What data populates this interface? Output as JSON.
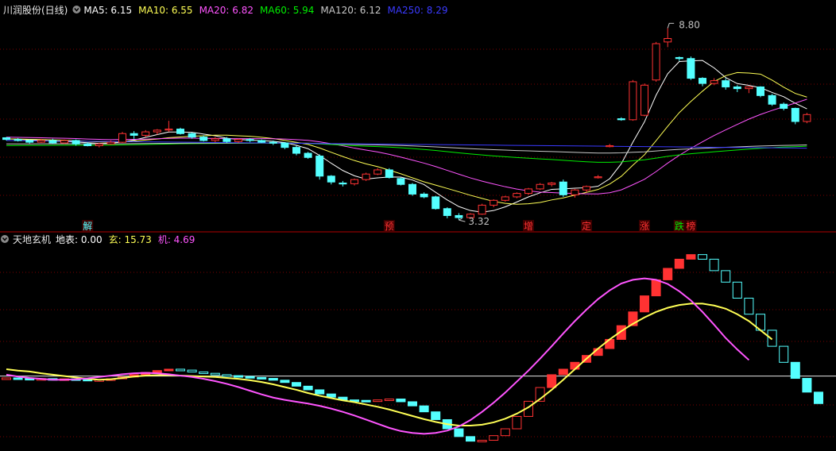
{
  "colors": {
    "background": "#000000",
    "grid": "#7a0000",
    "separator": "#b00000",
    "up": "#ff3232",
    "down": "#54ffff",
    "white": "#e0e0e0",
    "ma5": "#ffffff",
    "ma10": "#ffff55",
    "ma20": "#ff55ff",
    "ma60": "#00ee00",
    "ma120": "#c8c8c8",
    "ma250": "#3a3aff",
    "label_up": "#ff3232",
    "label_cyan": "#54ffff",
    "label_green": "#00ee00"
  },
  "top_panel": {
    "title": "川润股份(日线)",
    "legend": [
      {
        "name": "MA5",
        "value": "6.15",
        "color": "#ffffff"
      },
      {
        "name": "MA10",
        "value": "6.55",
        "color": "#ffff55"
      },
      {
        "name": "MA20",
        "value": "6.82",
        "color": "#ff55ff"
      },
      {
        "name": "MA60",
        "value": "5.94",
        "color": "#00ee00"
      },
      {
        "name": "MA120",
        "value": "6.12",
        "color": "#c8c8c8"
      },
      {
        "name": "MA250",
        "value": "8.29",
        "color": "#3a3aff"
      }
    ],
    "high_label": "8.80",
    "low_label": "3.32",
    "signals": [
      {
        "text": "解",
        "index": 7,
        "color": "#54ffff"
      },
      {
        "text": "预",
        "index": 33,
        "color": "#ff3232"
      },
      {
        "text": "增",
        "index": 45,
        "color": "#ff3232"
      },
      {
        "text": "定",
        "index": 50,
        "color": "#ff3232"
      },
      {
        "text": "涨",
        "index": 55,
        "color": "#ff3232"
      },
      {
        "text": "跌",
        "index": 58,
        "color": "#00ee00"
      },
      {
        "text": "榜",
        "index": 59,
        "color": "#ff3232"
      }
    ]
  },
  "bottom_panel": {
    "title": "天地玄机",
    "legend": [
      {
        "name": "地表",
        "value": "0.00",
        "color": "#ffffff"
      },
      {
        "name": "玄",
        "value": "15.73",
        "color": "#ffff55"
      },
      {
        "name": "机",
        "value": "4.69",
        "color": "#ff55ff"
      }
    ]
  },
  "chart_data": [
    {
      "type": "candlestick",
      "name": "川润股份(日线)",
      "ylim": [
        3.0,
        9.2
      ],
      "candles": [
        [
          5.63,
          5.65,
          5.55,
          5.58
        ],
        [
          5.58,
          5.62,
          5.52,
          5.55
        ],
        [
          5.55,
          5.58,
          5.46,
          5.5
        ],
        [
          5.5,
          5.6,
          5.48,
          5.55
        ],
        [
          5.55,
          5.6,
          5.45,
          5.48
        ],
        [
          5.48,
          5.58,
          5.45,
          5.55
        ],
        [
          5.55,
          5.58,
          5.4,
          5.45
        ],
        [
          5.45,
          5.5,
          5.38,
          5.4
        ],
        [
          5.4,
          5.48,
          5.35,
          5.45
        ],
        [
          5.45,
          5.55,
          5.43,
          5.5
        ],
        [
          5.5,
          5.8,
          5.48,
          5.75
        ],
        [
          5.75,
          5.82,
          5.6,
          5.7
        ],
        [
          5.7,
          5.85,
          5.65,
          5.8
        ],
        [
          5.8,
          5.88,
          5.72,
          5.85
        ],
        [
          5.88,
          6.12,
          5.8,
          5.88
        ],
        [
          5.88,
          5.92,
          5.72,
          5.75
        ],
        [
          5.75,
          5.78,
          5.6,
          5.65
        ],
        [
          5.65,
          5.7,
          5.52,
          5.55
        ],
        [
          5.55,
          5.65,
          5.5,
          5.6
        ],
        [
          5.6,
          5.65,
          5.48,
          5.52
        ],
        [
          5.52,
          5.6,
          5.48,
          5.58
        ],
        [
          5.58,
          5.62,
          5.5,
          5.55
        ],
        [
          5.55,
          5.58,
          5.48,
          5.5
        ],
        [
          5.5,
          5.55,
          5.42,
          5.48
        ],
        [
          5.48,
          5.5,
          5.3,
          5.35
        ],
        [
          5.35,
          5.4,
          5.12,
          5.18
        ],
        [
          5.18,
          5.22,
          5.02,
          5.06
        ],
        [
          5.1,
          5.15,
          4.42,
          4.52
        ],
        [
          4.52,
          4.55,
          4.28,
          4.35
        ],
        [
          4.32,
          4.38,
          4.22,
          4.3
        ],
        [
          4.3,
          4.45,
          4.25,
          4.42
        ],
        [
          4.42,
          4.62,
          4.38,
          4.58
        ],
        [
          4.58,
          4.75,
          4.55,
          4.7
        ],
        [
          4.7,
          4.75,
          4.45,
          4.48
        ],
        [
          4.45,
          4.48,
          4.25,
          4.28
        ],
        [
          4.28,
          4.32,
          3.95,
          4.0
        ],
        [
          4.0,
          4.05,
          3.88,
          3.92
        ],
        [
          3.92,
          3.95,
          3.55,
          3.58
        ],
        [
          3.58,
          3.62,
          3.3,
          3.38
        ],
        [
          3.38,
          3.45,
          3.25,
          3.32
        ],
        [
          3.32,
          3.45,
          3.28,
          3.42
        ],
        [
          3.42,
          3.72,
          3.4,
          3.68
        ],
        [
          3.68,
          3.85,
          3.62,
          3.82
        ],
        [
          3.82,
          3.95,
          3.78,
          3.92
        ],
        [
          3.92,
          4.05,
          3.88,
          4.02
        ],
        [
          4.02,
          4.18,
          3.98,
          4.15
        ],
        [
          4.15,
          4.32,
          4.12,
          4.28
        ],
        [
          4.28,
          4.35,
          4.22,
          4.32
        ],
        [
          4.35,
          4.42,
          3.92,
          3.98
        ],
        [
          3.98,
          4.15,
          3.9,
          4.12
        ],
        [
          4.12,
          4.25,
          4.05,
          4.22
        ],
        [
          4.48,
          4.55,
          4.45,
          4.5
        ],
        [
          5.4,
          5.45,
          5.35,
          5.4
        ],
        [
          6.18,
          6.22,
          6.12,
          6.15
        ],
        [
          6.15,
          7.3,
          6.12,
          7.25
        ],
        [
          6.28,
          7.2,
          6.25,
          7.15
        ],
        [
          7.3,
          8.4,
          7.25,
          8.35
        ],
        [
          8.4,
          8.8,
          8.25,
          8.5
        ],
        [
          7.95,
          7.98,
          7.85,
          7.92
        ],
        [
          7.92,
          7.98,
          7.3,
          7.35
        ],
        [
          7.35,
          7.38,
          7.12,
          7.2
        ],
        [
          7.2,
          7.35,
          7.15,
          7.28
        ],
        [
          7.28,
          7.35,
          7.02,
          7.1
        ],
        [
          7.1,
          7.15,
          6.95,
          7.05
        ],
        [
          7.05,
          7.12,
          6.92,
          7.1
        ],
        [
          7.1,
          7.12,
          6.8,
          6.85
        ],
        [
          6.85,
          6.9,
          6.55,
          6.6
        ],
        [
          6.6,
          6.65,
          6.42,
          6.48
        ],
        [
          6.48,
          6.5,
          6.02,
          6.1
        ],
        [
          6.1,
          6.35,
          6.05,
          6.3
        ]
      ]
    },
    {
      "type": "bar",
      "name": "天地玄机",
      "ylim": [
        -16,
        28
      ],
      "bars": [
        -0.4,
        -0.5,
        -0.55,
        -0.55,
        -0.6,
        -0.6,
        -0.7,
        -0.8,
        -0.8,
        -0.6,
        -0.2,
        0.3,
        0.8,
        1.2,
        1.5,
        1.3,
        0.9,
        0.6,
        0.3,
        0.1,
        -0.1,
        -0.3,
        -0.5,
        -0.9,
        -1.4,
        -2.2,
        -3.0,
        -3.9,
        -4.6,
        -5.2,
        -5.3,
        -5.4,
        -5.2,
        -5.0,
        -5.6,
        -6.5,
        -7.8,
        -9.5,
        -11.5,
        -13.2,
        -14.2,
        -14.0,
        -13.0,
        -11.5,
        -8.8,
        -5.5,
        -2.5,
        0.3,
        1.5,
        3.0,
        4.5,
        6.0,
        8.0,
        11.0,
        14.0,
        17.5,
        21.0,
        23.5,
        25.5,
        26.5,
        25.5,
        23.0,
        20.5,
        17.0,
        13.5,
        10.0,
        6.5,
        3.0,
        -0.5,
        -3.5,
        -6.0
      ],
      "xuan": [
        1.5,
        1.2,
        1.0,
        0.6,
        0.3,
        0.0,
        -0.3,
        -0.6,
        -0.8,
        -0.7,
        -0.4,
        -0.1,
        0.1,
        0.2,
        0.2,
        0.1,
        0.0,
        -0.1,
        -0.2,
        -0.4,
        -0.6,
        -0.9,
        -1.3,
        -1.8,
        -2.4,
        -3.0,
        -3.7,
        -4.3,
        -4.8,
        -5.3,
        -5.7,
        -6.2,
        -6.7,
        -7.3,
        -8.0,
        -8.7,
        -9.4,
        -10.0,
        -10.5,
        -10.8,
        -10.8,
        -10.6,
        -10.1,
        -9.3,
        -8.2,
        -6.8,
        -5.0,
        -3.0,
        -0.8,
        1.5,
        3.8,
        6.0,
        8.0,
        9.8,
        11.4,
        12.8,
        14.0,
        14.9,
        15.5,
        15.8,
        15.8,
        15.4,
        14.7,
        13.5,
        12.0,
        10.0,
        8.0
      ],
      "ji": [
        0.3,
        -0.1,
        -0.4,
        -0.6,
        -0.8,
        -0.8,
        -0.7,
        -0.5,
        -0.2,
        0.1,
        0.4,
        0.6,
        0.7,
        0.6,
        0.4,
        0.1,
        -0.2,
        -0.6,
        -1.1,
        -1.7,
        -2.4,
        -3.2,
        -4.0,
        -4.7,
        -5.2,
        -5.6,
        -6.0,
        -6.5,
        -7.1,
        -7.8,
        -8.6,
        -9.5,
        -10.4,
        -11.3,
        -12.0,
        -12.4,
        -12.6,
        -12.4,
        -11.9,
        -11.0,
        -9.6,
        -7.8,
        -5.8,
        -3.6,
        -1.2,
        1.2,
        3.8,
        6.5,
        9.3,
        12.0,
        14.5,
        16.8,
        18.7,
        20.2,
        21.0,
        21.3,
        21.0,
        20.1,
        18.5,
        16.5,
        14.0,
        11.2,
        8.3,
        5.8,
        3.5
      ]
    }
  ]
}
